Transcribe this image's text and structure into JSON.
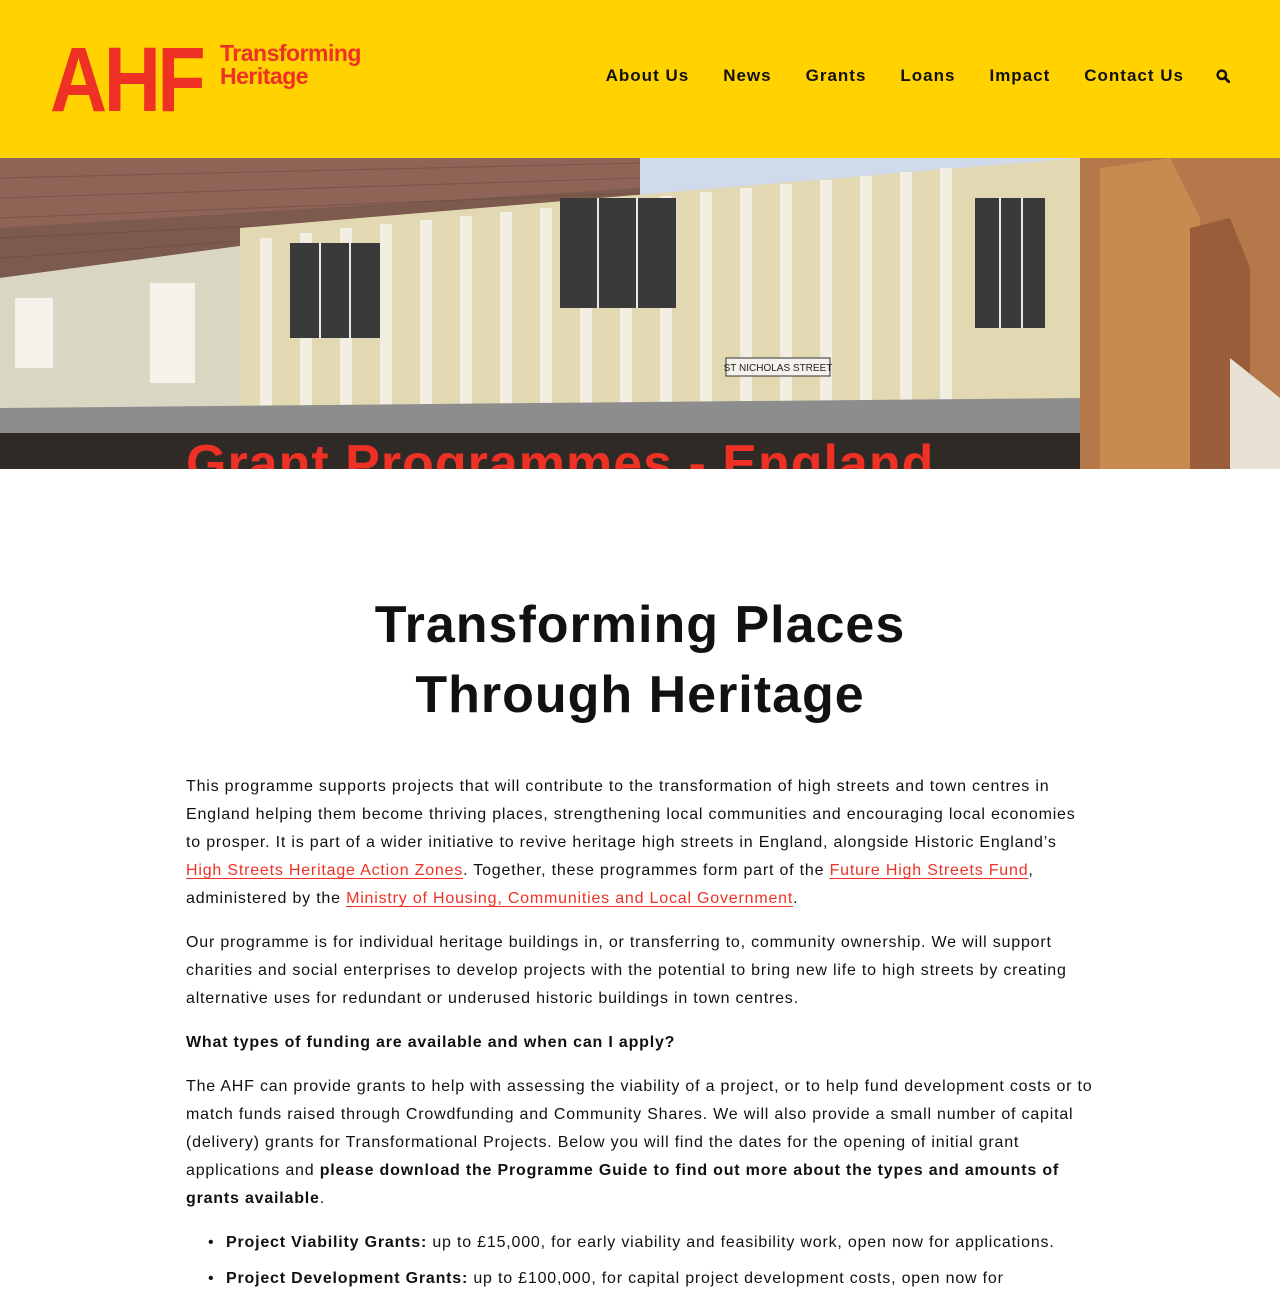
{
  "header": {
    "logo": {
      "mark": "AHF",
      "tagline_line1": "Transforming",
      "tagline_line2": "Heritage"
    },
    "nav": [
      {
        "label": "About Us"
      },
      {
        "label": "News"
      },
      {
        "label": "Grants"
      },
      {
        "label": "Loans"
      },
      {
        "label": "Impact"
      },
      {
        "label": "Contact Us"
      }
    ],
    "search_icon": "search-icon"
  },
  "hero": {
    "title": "Grant Programmes - England",
    "street_sign": "ST NICHOLAS STREET"
  },
  "main": {
    "heading_line1": "Transforming Places",
    "heading_line2": "Through Heritage",
    "p1": {
      "text1": "This programme supports projects that will contribute to the transformation of high streets and town centres in England helping them become thriving places, strengthening local communities and encouraging local economies to prosper.  It is part of a wider initiative to revive heritage high streets in England, alongside Historic England’s ",
      "link1": "High Streets Heritage Action Zones",
      "text2": ". Together, these programmes form part of the ",
      "link2": "Future High Streets Fund",
      "text3": ", administered by the ",
      "link3": "Ministry of Housing, Communities and Local Government",
      "text4": "."
    },
    "p2": "Our programme is for individual heritage buildings in, or transferring to, community ownership. We will support charities and social enterprises to develop projects with the potential to bring new life to high streets by creating alternative uses for redundant or underused historic buildings in town centres.",
    "funding_question": "What types of funding are available and when can I apply?",
    "p3": {
      "text1": "The AHF can provide grants to help with assessing the viability of a project, or to help fund development costs or to match funds raised through Crowdfunding and Community Shares. We will also provide a small number of capital (delivery) grants for Transformational Projects. Below you will find the dates for the opening of initial grant applications and ",
      "bold": "please download the Programme Guide to find out more about the types and amounts of grants available",
      "text2": "."
    },
    "grants": [
      {
        "name": "Project Viability Grants:",
        "desc": " up to £15,000, for early viability and feasibility work, open now for applications."
      },
      {
        "name": "Project Development Grants:",
        "desc": " up to £100,000, for capital project development costs, open now for"
      }
    ]
  },
  "colors": {
    "brand_yellow": "#ffd200",
    "brand_red": "#ee3124",
    "text": "#111111"
  }
}
